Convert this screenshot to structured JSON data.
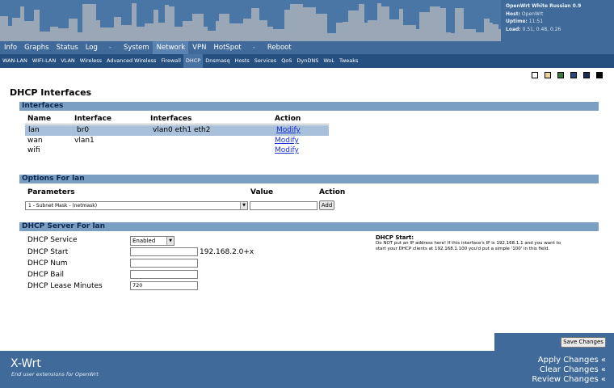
{
  "header": {
    "sysinfo": {
      "firmware": "OpenWrt White Russian 0.9",
      "host_label": "Host:",
      "host": "OpenWrt",
      "uptime_label": "Uptime:",
      "uptime": "11:51",
      "load_label": "Load:",
      "load": "0.51, 0.48, 0.26"
    }
  },
  "main_menu": [
    "Info",
    "Graphs",
    "Status",
    "Log",
    "-",
    "System",
    "Network",
    "VPN",
    "HotSpot",
    "-",
    "Reboot"
  ],
  "main_menu_active": "Network",
  "sub_menu": [
    "WAN-LAN",
    "WIFI-LAN",
    "VLAN",
    "Wireless",
    "Advanced Wireless",
    "Firewall",
    "DHCP",
    "Dnsmasq",
    "Hosts",
    "Services",
    "QoS",
    "DynDNS",
    "WoL",
    "Tweaks"
  ],
  "sub_menu_active": "DHCP",
  "swatches": [
    "#ffffff",
    "#f2cf95",
    "#3c7a3c",
    "#2a4a78",
    "#1a2a55",
    "#000000"
  ],
  "page_title": "DHCP Interfaces",
  "interfaces": {
    "section": "Interfaces",
    "headers": {
      "name": "Name",
      "interface": "Interface",
      "interfaces": "Interfaces",
      "action": "Action"
    },
    "rows": [
      {
        "name": "lan",
        "interface": "br0",
        "interfaces": "vlan0 eth1 eth2",
        "action": "Modify"
      },
      {
        "name": "wan",
        "interface": "vlan1",
        "interfaces": "",
        "action": "Modify"
      },
      {
        "name": "wifi",
        "interface": "",
        "interfaces": "",
        "action": "Modify"
      }
    ]
  },
  "options": {
    "section": "Options For lan",
    "headers": {
      "parameters": "Parameters",
      "value": "Value",
      "action": "Action"
    },
    "selected_param": "1 - Subnet Mask - (netmask)",
    "value": "",
    "add_label": "Add"
  },
  "server": {
    "section": "DHCP Server For lan",
    "service_label": "DHCP Service",
    "service_value": "Enabled",
    "start_label": "DHCP Start",
    "start_value": "",
    "start_suffix": "192.168.2.0+x",
    "num_label": "DHCP Num",
    "num_value": "",
    "bail_label": "DHCP Bail",
    "bail_value": "",
    "lease_label": "DHCP Lease Minutes",
    "lease_value": "720",
    "help_title": "DHCP Start:",
    "help_text": "Do NOT put an IP address here! If this interface's IP is 192.168.1.1 and you want to start your DHCP clients at 192.168.1.100 you'd put a simple '100' in this field."
  },
  "footer": {
    "save_label": "Save Changes",
    "brand": "X-Wrt",
    "tagline": "End user extensions for OpenWrt",
    "apply": "Apply Changes «",
    "clear": "Clear Changes «",
    "review": "Review Changes «"
  }
}
